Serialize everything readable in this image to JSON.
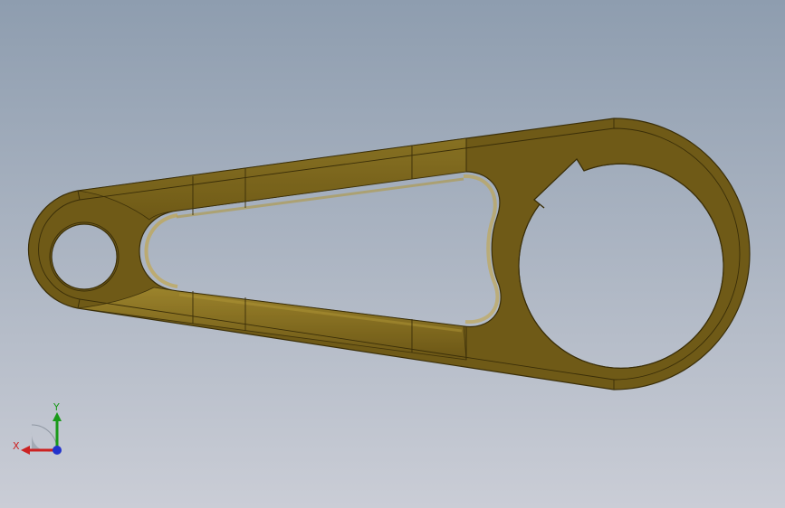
{
  "viewport": {
    "background_top": "#8e9daf",
    "background_bottom": "#c9cdd6"
  },
  "part": {
    "face_color": "#6f5a17",
    "face_light": "#8a7424",
    "edge_color": "#3a2e08",
    "highlight_color": "#a88f32"
  },
  "triad": {
    "x_label": "X",
    "y_label": "Y",
    "x_color": "#cc2222",
    "y_color": "#1a9a1a",
    "z_color": "#2233cc"
  }
}
